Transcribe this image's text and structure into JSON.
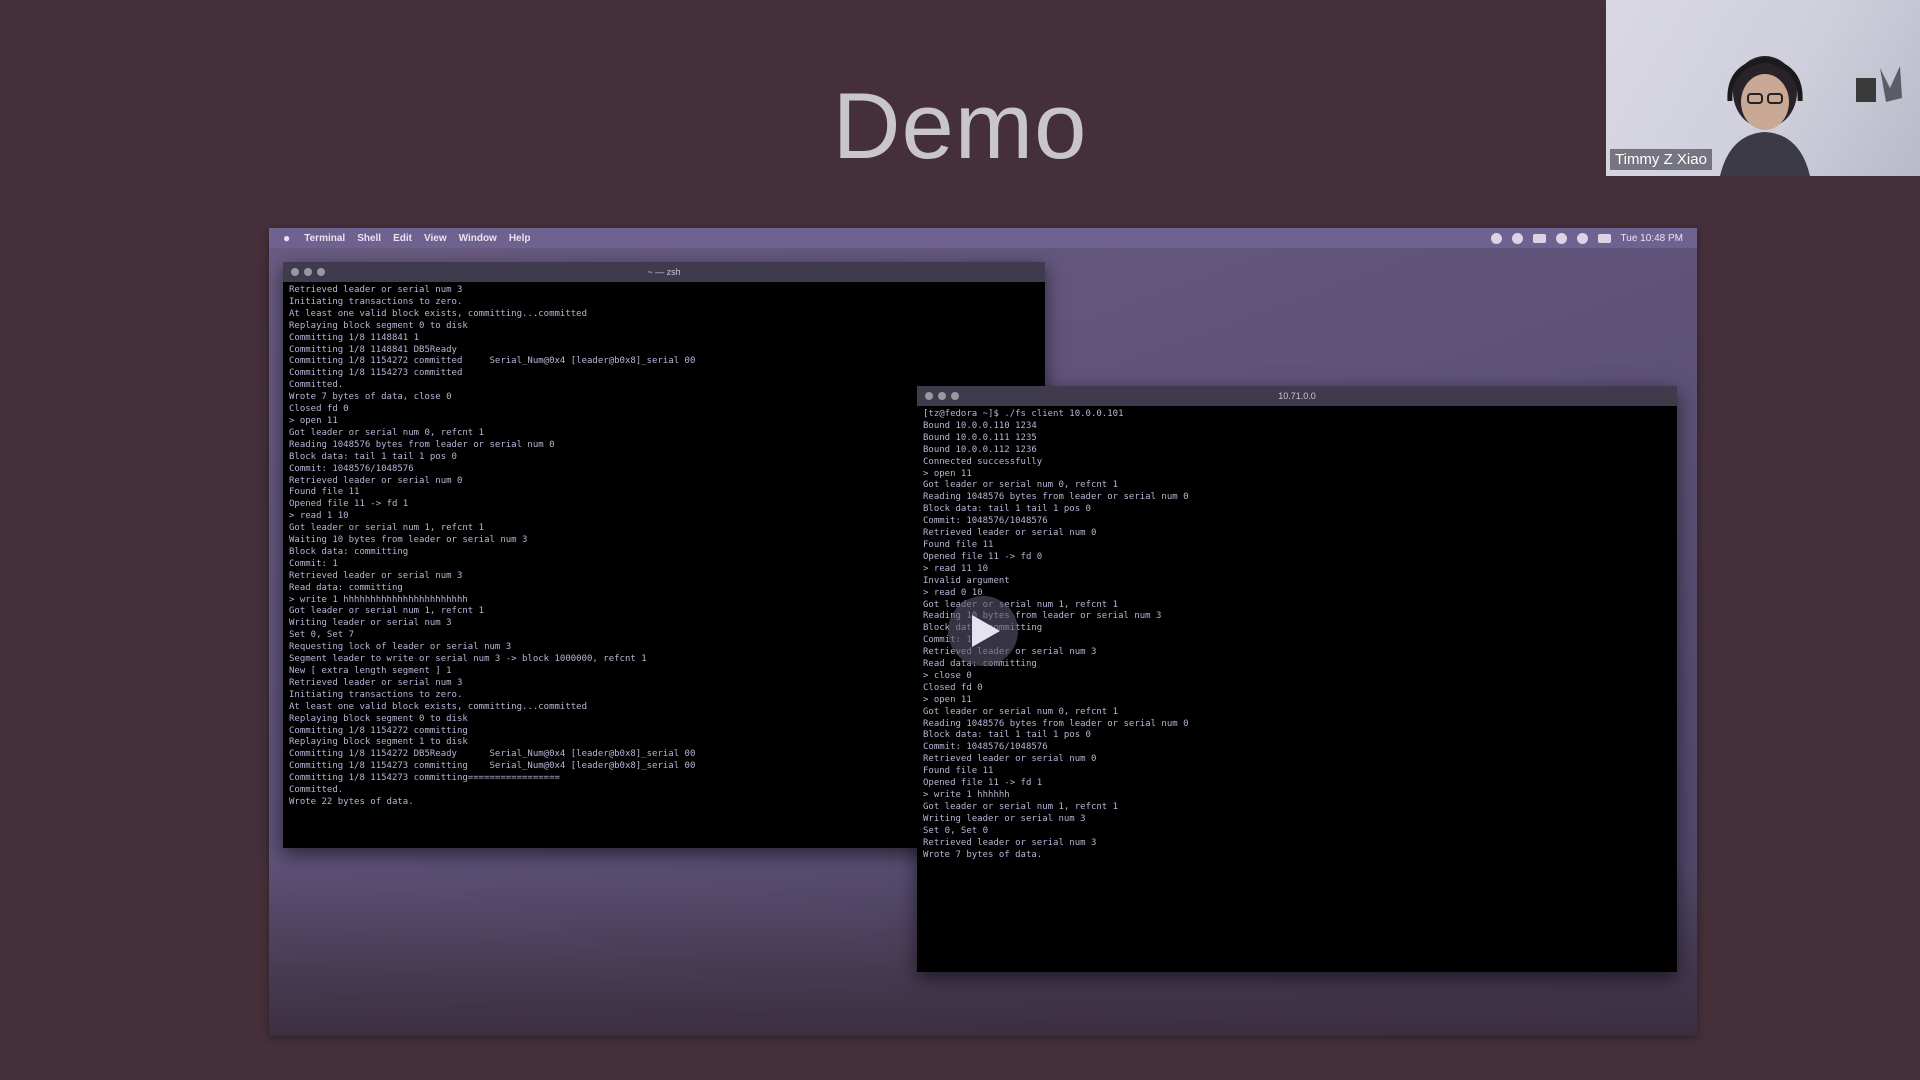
{
  "slide": {
    "title": "Demo"
  },
  "video": {
    "menubar": {
      "items": [
        "Terminal",
        "Shell",
        "Edit",
        "View",
        "Window",
        "Help"
      ],
      "clock": "Tue 10:48 PM"
    },
    "left_terminal": {
      "title": "~ — zsh",
      "lines": [
        "Retrieved leader or serial num 3",
        "Initiating transactions to zero.",
        "At least one valid block exists, committing...committed",
        "Replaying block segment 0 to disk",
        "Committing 1/8 1148841 1",
        "Committing 1/8 1148841 DB5Ready",
        "Committing 1/8 1154272 committed     Serial_Num@0x4 [leader@b0x8]_serial 00",
        "Committing 1/8 1154273 committed",
        "Committed.",
        "Wrote 7 bytes of data, close 0",
        "Closed fd 0",
        "> open 11",
        "Got leader or serial num 0, refcnt 1",
        "Reading 1048576 bytes from leader or serial num 0",
        "Block data: tail 1 tail 1 pos 0",
        "Commit: 1048576/1048576",
        "Retrieved leader or serial num 0",
        "Found file 11",
        "Opened file 11 -> fd 1",
        "> read 1 10",
        "Got leader or serial num 1, refcnt 1",
        "Waiting 10 bytes from leader or serial num 3",
        "Block data: committing",
        "Commit: 1",
        "Retrieved leader or serial num 3",
        "Read data: committing",
        "> write 1 hhhhhhhhhhhhhhhhhhhhhhh",
        "Got leader or serial num 1, refcnt 1",
        "Writing leader or serial num 3",
        "Set 0, Set 7",
        "Requesting lock of leader or serial num 3",
        "Segment leader to write or serial num 3 -> block 1000000, refcnt 1",
        "New [ extra length segment ] 1",
        "Retrieved leader or serial num 3",
        "Initiating transactions to zero.",
        "At least one valid block exists, committing...committed",
        "Replaying block segment 0 to disk",
        "Committing 1/8 1154272 committing",
        "Replaying block segment 1 to disk",
        "Committing 1/8 1154272 DB5Ready      Serial_Num@0x4 [leader@b0x8]_serial 00",
        "Committing 1/8 1154273 committing    Serial_Num@0x4 [leader@b0x8]_serial 00",
        "Committing 1/8 1154273 committing=================",
        "Committed.",
        "Wrote 22 bytes of data."
      ]
    },
    "right_terminal": {
      "title": "10.71.0.0",
      "lines": [
        "[tz@fedora ~]$ ./fs client 10.0.0.101",
        "Bound 10.0.0.110 1234",
        "Bound 10.0.0.111 1235",
        "Bound 10.0.0.112 1236",
        "Connected successfully",
        "> open 11",
        "Got leader or serial num 0, refcnt 1",
        "Reading 1048576 bytes from leader or serial num 0",
        "Block data: tail 1 tail 1 pos 0",
        "Commit: 1048576/1048576",
        "Retrieved leader or serial num 0",
        "Found file 11",
        "Opened file 11 -> fd 0",
        "> read 11 10",
        "Invalid argument",
        "> read 0 10",
        "Got leader or serial num 1, refcnt 1",
        "Reading 10 bytes from leader or serial num 3",
        "Block data: committing",
        "Commit: 1",
        "Retrieved leader or serial num 3",
        "Read data: committing",
        "> close 0",
        "Closed fd 0",
        "> open 11",
        "Got leader or serial num 0, refcnt 1",
        "Reading 1048576 bytes from leader or serial num 0",
        "Block data: tail 1 tail 1 pos 0",
        "Commit: 1048576/1048576",
        "Retrieved leader or serial num 0",
        "Found file 11",
        "Opened file 11 -> fd 1",
        "> write 1 hhhhhh",
        "Got leader or serial num 1, refcnt 1",
        "Writing leader or serial num 3",
        "Set 0, Set 0",
        "Retrieved leader or serial num 3",
        "Wrote 7 bytes of data."
      ]
    }
  },
  "participant": {
    "name": "Timmy Z Xiao"
  }
}
